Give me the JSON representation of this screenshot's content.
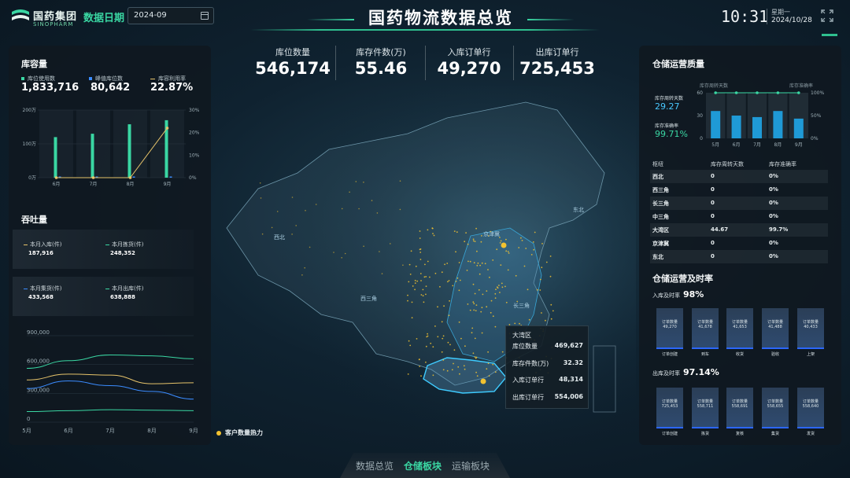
{
  "header": {
    "logo_text": "国药集团",
    "logo_sub": "SINOPHARM",
    "date_label": "数据日期",
    "date_value": "2024-09",
    "title": "国药物流数据总览",
    "time": "10:31",
    "weekday": "星期一",
    "date": "2024/10/28"
  },
  "kpis": [
    {
      "label": "库位数量",
      "value": "546,174"
    },
    {
      "label": "库存件数(万)",
      "value": "55.46"
    },
    {
      "label": "入库订单行",
      "value": "49,270"
    },
    {
      "label": "出库订单行",
      "value": "725,453"
    }
  ],
  "capacity": {
    "title": "库容量",
    "legend": [
      {
        "label": "库位使用数",
        "value": "1,833,716",
        "color": "#3ad7a3"
      },
      {
        "label": "峰值库位数",
        "value": "80,642",
        "color": "#3b8cff"
      },
      {
        "label": "库容利用率",
        "value": "22.87%",
        "color": "#e6c36a"
      }
    ]
  },
  "throughput": {
    "title": "吞吐量",
    "cards": [
      {
        "label": "本月入库(件)",
        "value": "187,916",
        "color": "#e6c36a"
      },
      {
        "label": "本月拣货(件)",
        "value": "248,352",
        "color": "#3ad7a3"
      },
      {
        "label": "本月集货(件)",
        "value": "433,568",
        "color": "#3b8cff"
      },
      {
        "label": "本月出库(件)",
        "value": "638,888",
        "color": "#3ad7a3"
      }
    ]
  },
  "chart_data": [
    {
      "type": "bar",
      "categories": [
        "6月",
        "7月",
        "8月",
        "9月"
      ],
      "series": [
        {
          "name": "库位使用数",
          "values": [
            120,
            130,
            158,
            170
          ]
        },
        {
          "name": "峰值库位数",
          "values": [
            0,
            0,
            0,
            0
          ]
        },
        {
          "name": "库容利用率",
          "values": [
            0,
            0,
            0,
            22
          ]
        }
      ],
      "y_left_ticks": [
        "200万",
        "100万",
        "0万"
      ],
      "y_left_range": [
        0,
        200
      ],
      "y_right_ticks": [
        "30%",
        "20%",
        "10%",
        "0%"
      ],
      "y_right_range": [
        0,
        30
      ]
    },
    {
      "type": "line",
      "x": [
        "5月",
        "6月",
        "7月",
        "8月",
        "9月"
      ],
      "y_ticks": [
        "900,000",
        "600,000",
        "300,000",
        "0"
      ],
      "ylim": [
        0,
        900000
      ],
      "series": [
        {
          "values": [
            560000,
            640000,
            700000,
            690000,
            660000
          ],
          "color": "#3ad7a3"
        },
        {
          "values": [
            440000,
            500000,
            490000,
            400000,
            410000
          ],
          "color": "#e6c36a"
        },
        {
          "values": [
            350000,
            430000,
            380000,
            320000,
            240000
          ],
          "color": "#3b8cff"
        },
        {
          "values": [
            110000,
            120000,
            130000,
            125000,
            120000
          ],
          "color": "#3ad7a3"
        }
      ]
    },
    {
      "type": "bar",
      "categories": [
        "5月",
        "6月",
        "7月",
        "8月",
        "9月"
      ],
      "series": [
        {
          "name": "库存周转天数",
          "values": [
            36,
            30,
            28,
            36,
            26
          ]
        },
        {
          "name": "库存准确率",
          "values": [
            100,
            100,
            100,
            100,
            100
          ]
        }
      ],
      "y_left_ticks": [
        "60",
        "30",
        "0"
      ],
      "y_left_range": [
        0,
        60
      ],
      "y_right_ticks": [
        "100%",
        "50%",
        "0%"
      ],
      "y_right_range": [
        0,
        100
      ]
    }
  ],
  "map": {
    "labels": [
      "西北",
      "京津冀",
      "东北",
      "西三角",
      "长三角",
      "大湾区"
    ],
    "legend": "客户数量热力",
    "tooltip": {
      "title": "大湾区",
      "rows": [
        {
          "label": "库位数量",
          "value": "469,627"
        },
        {
          "label": "库存件数(万)",
          "value": "32.32"
        },
        {
          "label": "入库订单行",
          "value": "48,314"
        },
        {
          "label": "出库订单行",
          "value": "554,006"
        }
      ]
    }
  },
  "quality": {
    "title": "仓储运营质量",
    "turnover_label": "库存周转天数",
    "turnover_value": "29.27",
    "accuracy_label": "库存准确率",
    "accuracy_value": "99.71%",
    "chart_legend_left": "库存周转天数",
    "chart_legend_right": "库存准确率",
    "table": {
      "headers": [
        "枢纽",
        "库存周转天数",
        "库存准确率"
      ],
      "rows": [
        [
          "西北",
          "0",
          "0%"
        ],
        [
          "西三角",
          "0",
          "0%"
        ],
        [
          "长三角",
          "0",
          "0%"
        ],
        [
          "中三角",
          "0",
          "0%"
        ],
        [
          "大湾区",
          "44.67",
          "99.7%"
        ],
        [
          "京津冀",
          "0",
          "0%"
        ],
        [
          "东北",
          "0",
          "0%"
        ]
      ]
    }
  },
  "timeliness": {
    "title": "仓储运营及时率",
    "inbound_label": "入库及时率",
    "inbound_rate": "98%",
    "inbound_bars": [
      {
        "title": "订单数量",
        "value": "49,270",
        "caption": "订单创建"
      },
      {
        "title": "订单数量",
        "value": "41,678",
        "caption": "到车"
      },
      {
        "title": "订单数量",
        "value": "41,653",
        "caption": "收货"
      },
      {
        "title": "订单数量",
        "value": "41,488",
        "caption": "验收"
      },
      {
        "title": "订单数量",
        "value": "40,433",
        "caption": "上架"
      }
    ],
    "outbound_label": "出库及时率",
    "outbound_rate": "97.14%",
    "outbound_bars": [
      {
        "title": "订单数量",
        "value": "725,453",
        "caption": "订单创建"
      },
      {
        "title": "订单数量",
        "value": "558,711",
        "caption": "拣货"
      },
      {
        "title": "订单数量",
        "value": "558,691",
        "caption": "复核"
      },
      {
        "title": "订单数量",
        "value": "558,655",
        "caption": "集货"
      },
      {
        "title": "订单数量",
        "value": "558,640",
        "caption": "发货"
      }
    ]
  },
  "tabs": [
    "数据总览",
    "仓储板块",
    "运输板块"
  ],
  "colors": {
    "accent": "#3ad7a3",
    "blue": "#3b8cff",
    "gold": "#e6c36a",
    "heat": "#f2c230"
  },
  "icons": [
    "calendar-icon",
    "fullscreen-icon",
    "logo-icon"
  ]
}
